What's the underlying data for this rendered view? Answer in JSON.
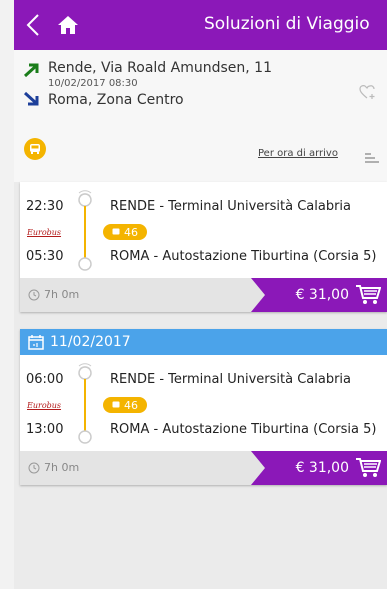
{
  "header": {
    "title": "Soluzioni di Viaggio",
    "back_icon": "chevron-left-icon",
    "home_icon": "home-icon",
    "color": "#8b18b8"
  },
  "route": {
    "from": "Rende, Via Roald Amundsen, 11",
    "datetime": "10/02/2017 08:30",
    "to": "Roma, Zona Centro"
  },
  "sort": {
    "label": "Per ora di arrivo"
  },
  "results": [
    {
      "depart_time": "22:30",
      "depart_place": "RENDE - Terminal Università Calabria",
      "arrive_time": "05:30",
      "arrive_place": "ROMA - Autostazione Tiburtina (Corsia 5)",
      "operator": "Eurobus",
      "line": "46",
      "duration": "7h 0m",
      "price": "€ 31,00"
    },
    {
      "date": "11/02/2017",
      "depart_time": "06:00",
      "depart_place": "RENDE - Terminal Università Calabria",
      "arrive_time": "13:00",
      "arrive_place": "ROMA - Autostazione Tiburtina (Corsia 5)",
      "operator": "Eurobus",
      "line": "46",
      "duration": "7h 0m",
      "price": "€ 31,00"
    }
  ],
  "colors": {
    "accent": "#8b18b8",
    "date_bar": "#4ba3ea",
    "badge": "#f4b400"
  }
}
